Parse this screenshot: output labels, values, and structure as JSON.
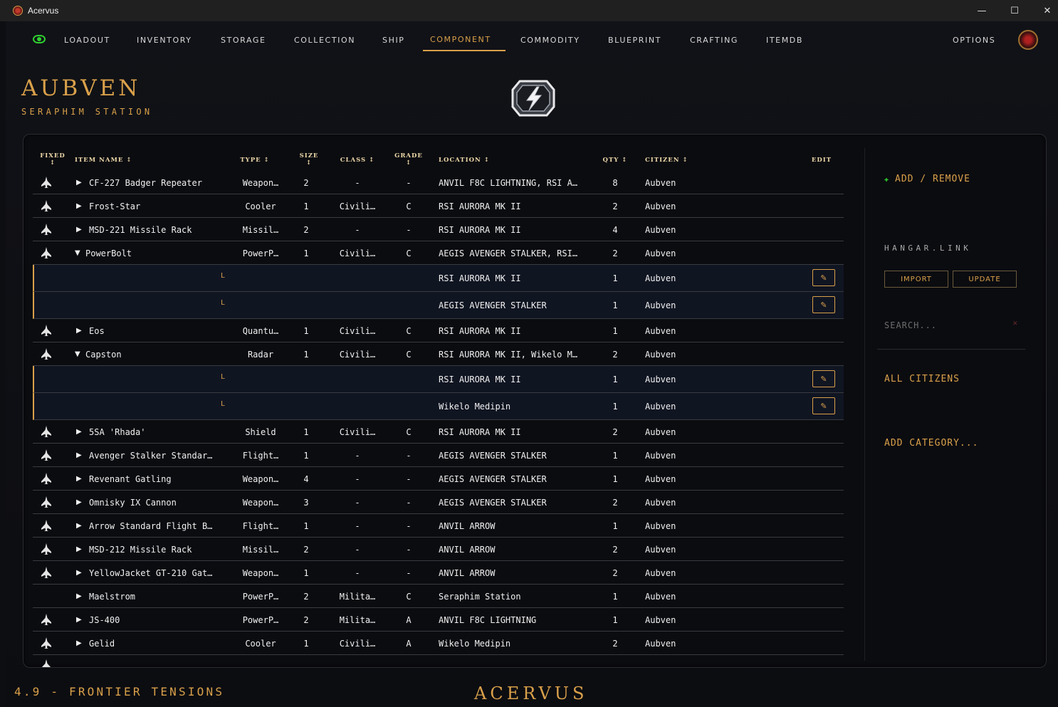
{
  "window": {
    "title": "Acervus",
    "minimize": "—",
    "maximize": "☐",
    "close": "✕"
  },
  "nav": {
    "items": [
      "LOADOUT",
      "INVENTORY",
      "STORAGE",
      "COLLECTION",
      "SHIP",
      "COMPONENT",
      "COMMODITY",
      "BLUEPRINT",
      "CRAFTING",
      "ITEMDB"
    ],
    "active": "COMPONENT",
    "options": "OPTIONS"
  },
  "header": {
    "title": "AUBVEN",
    "subtitle": "SERAPHIM STATION"
  },
  "table": {
    "columns": {
      "fixed": "FIXED\n↕",
      "item_name": "ITEM NAME ↕",
      "type": "TYPE ↕",
      "size": "SIZE\n↕",
      "class": "CLASS ↕",
      "grade": "GRADE\n↕",
      "location": "LOCATION ↕",
      "qty": "QTY ↕",
      "citizen": "CITIZEN ↕",
      "edit": "EDIT"
    },
    "rows": [
      {
        "fixed": true,
        "expanded": false,
        "name": "CF-227 Badger Repeater",
        "type": "Weapon…",
        "size": "2",
        "class": "-",
        "grade": "-",
        "location": "ANVIL F8C LIGHTNING, RSI A…",
        "qty": "8",
        "citizen": "Aubven"
      },
      {
        "fixed": true,
        "expanded": false,
        "name": "Frost-Star",
        "type": "Cooler",
        "size": "1",
        "class": "Civili…",
        "grade": "C",
        "location": "RSI AURORA MK II",
        "qty": "2",
        "citizen": "Aubven"
      },
      {
        "fixed": true,
        "expanded": false,
        "name": "MSD-221 Missile Rack",
        "type": "Missil…",
        "size": "2",
        "class": "-",
        "grade": "-",
        "location": "RSI AURORA MK II",
        "qty": "4",
        "citizen": "Aubven"
      },
      {
        "fixed": true,
        "expanded": true,
        "name": "PowerBolt",
        "type": "PowerP…",
        "size": "1",
        "class": "Civili…",
        "grade": "C",
        "location": "AEGIS AVENGER STALKER, RSI…",
        "qty": "2",
        "citizen": "Aubven",
        "children": [
          {
            "marker": "L",
            "location": "RSI AURORA MK II",
            "qty": "1",
            "citizen": "Aubven",
            "edit_icon": "pencil-icon"
          },
          {
            "marker": "L",
            "location": "AEGIS AVENGER STALKER",
            "qty": "1",
            "citizen": "Aubven",
            "edit_icon": "pencil-icon"
          }
        ]
      },
      {
        "fixed": true,
        "expanded": false,
        "name": "Eos",
        "type": "Quantu…",
        "size": "1",
        "class": "Civili…",
        "grade": "C",
        "location": "RSI AURORA MK II",
        "qty": "1",
        "citizen": "Aubven"
      },
      {
        "fixed": true,
        "expanded": true,
        "name": "Capston",
        "type": "Radar",
        "size": "1",
        "class": "Civili…",
        "grade": "C",
        "location": "RSI AURORA MK II, Wikelo M…",
        "qty": "2",
        "citizen": "Aubven",
        "children": [
          {
            "marker": "L",
            "location": "RSI AURORA MK II",
            "qty": "1",
            "citizen": "Aubven",
            "edit_icon": "pencil-icon"
          },
          {
            "marker": "L",
            "location": "Wikelo Medipin",
            "qty": "1",
            "citizen": "Aubven",
            "edit_icon": "pencil-icon"
          }
        ]
      },
      {
        "fixed": true,
        "expanded": false,
        "name": "5SA 'Rhada'",
        "type": "Shield",
        "size": "1",
        "class": "Civili…",
        "grade": "C",
        "location": "RSI AURORA MK II",
        "qty": "2",
        "citizen": "Aubven"
      },
      {
        "fixed": true,
        "expanded": false,
        "name": "Avenger Stalker Standar…",
        "type": "Flight…",
        "size": "1",
        "class": "-",
        "grade": "-",
        "location": "AEGIS AVENGER STALKER",
        "qty": "1",
        "citizen": "Aubven"
      },
      {
        "fixed": true,
        "expanded": false,
        "name": "Revenant Gatling",
        "type": "Weapon…",
        "size": "4",
        "class": "-",
        "grade": "-",
        "location": "AEGIS AVENGER STALKER",
        "qty": "1",
        "citizen": "Aubven"
      },
      {
        "fixed": true,
        "expanded": false,
        "name": "Omnisky IX Cannon",
        "type": "Weapon…",
        "size": "3",
        "class": "-",
        "grade": "-",
        "location": "AEGIS AVENGER STALKER",
        "qty": "2",
        "citizen": "Aubven"
      },
      {
        "fixed": true,
        "expanded": false,
        "name": "Arrow Standard Flight B…",
        "type": "Flight…",
        "size": "1",
        "class": "-",
        "grade": "-",
        "location": "ANVIL ARROW",
        "qty": "1",
        "citizen": "Aubven"
      },
      {
        "fixed": true,
        "expanded": false,
        "name": "MSD-212 Missile Rack",
        "type": "Missil…",
        "size": "2",
        "class": "-",
        "grade": "-",
        "location": "ANVIL ARROW",
        "qty": "2",
        "citizen": "Aubven"
      },
      {
        "fixed": true,
        "expanded": false,
        "name": "YellowJacket GT-210 Gat…",
        "type": "Weapon…",
        "size": "1",
        "class": "-",
        "grade": "-",
        "location": "ANVIL ARROW",
        "qty": "2",
        "citizen": "Aubven"
      },
      {
        "fixed": false,
        "expanded": false,
        "name": "Maelstrom",
        "type": "PowerP…",
        "size": "2",
        "class": "Milita…",
        "grade": "C",
        "location": "Seraphim Station",
        "qty": "1",
        "citizen": "Aubven"
      },
      {
        "fixed": true,
        "expanded": false,
        "name": "JS-400",
        "type": "PowerP…",
        "size": "2",
        "class": "Milita…",
        "grade": "A",
        "location": "ANVIL F8C LIGHTNING",
        "qty": "1",
        "citizen": "Aubven"
      },
      {
        "fixed": true,
        "expanded": false,
        "name": "Gelid",
        "type": "Cooler",
        "size": "1",
        "class": "Civili…",
        "grade": "A",
        "location": "Wikelo Medipin",
        "qty": "2",
        "citizen": "Aubven"
      }
    ]
  },
  "sidebar": {
    "add_remove": "ADD / REMOVE",
    "hangar_link": "HANGAR.LINK",
    "import": "IMPORT",
    "update": "UPDATE",
    "search_placeholder": "SEARCH...",
    "search_clear": "✕",
    "all_citizens": "ALL CITIZENS",
    "add_category": "ADD CATEGORY..."
  },
  "footer": {
    "version": "4.9 - FRONTIER TENSIONS",
    "logo": "ACERVUS"
  },
  "colors": {
    "accent": "#d9a04a",
    "eye": "#2fd12f",
    "subrow": "#101522"
  },
  "icons": {
    "fixed": "ship-icon",
    "edit": "pencil-icon",
    "expand": "triangle-right-icon",
    "collapse": "triangle-down-icon",
    "component": "lightning-icon"
  }
}
